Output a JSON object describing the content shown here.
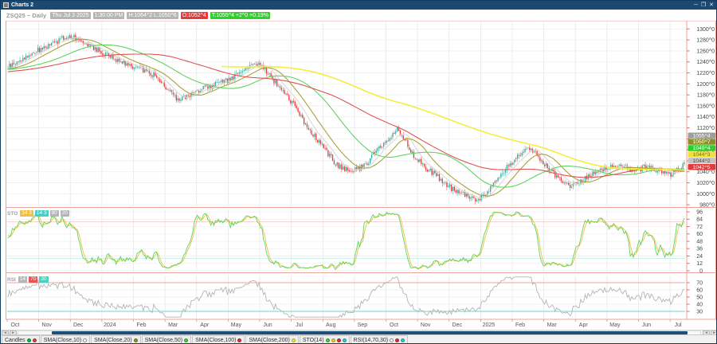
{
  "window": {
    "title": "Charts 2",
    "controls": [
      {
        "name": "minimize",
        "glyph": "─"
      },
      {
        "name": "maximize",
        "glyph": "❐"
      },
      {
        "name": "close",
        "glyph": "✕"
      }
    ]
  },
  "toolbar": {
    "symbol": "ZSQ25 ~ Daily",
    "date_badge": "Thu Jul 3 2025",
    "time_badge": "1:30:00 PM",
    "high_low_badge": "H:1064^2 L:1050^6",
    "open_badge": "O:1052^4",
    "last_badge": "T:1055^4 +2^0 +0.19%"
  },
  "chart_data": {
    "type": "candlestick",
    "symbol": "ZSQ25",
    "timeframe": "Daily",
    "x_axis_labels": [
      "Oct",
      "Nov",
      "Dec",
      "2024",
      "Feb",
      "Mar",
      "Apr",
      "May",
      "Jun",
      "Jul",
      "Aug",
      "Sep",
      "Oct",
      "Nov",
      "Dec",
      "2025",
      "Feb",
      "Mar",
      "Apr",
      "May",
      "Jun",
      "Jul"
    ],
    "days_per_month": 21,
    "price_axis": {
      "tick_min": 980,
      "tick_max": 1300,
      "tick_step": 20,
      "tick_suffix": "^0"
    },
    "last_price": "1055^4",
    "price_anchors_day_price": [
      [
        0,
        1230
      ],
      [
        8,
        1243
      ],
      [
        16,
        1256
      ],
      [
        24,
        1266
      ],
      [
        32,
        1276
      ],
      [
        40,
        1287
      ],
      [
        48,
        1283
      ],
      [
        56,
        1268
      ],
      [
        63,
        1256
      ],
      [
        70,
        1247
      ],
      [
        77,
        1240
      ],
      [
        84,
        1231
      ],
      [
        91,
        1225
      ],
      [
        98,
        1215
      ],
      [
        105,
        1195
      ],
      [
        112,
        1172
      ],
      [
        119,
        1176
      ],
      [
        126,
        1188
      ],
      [
        133,
        1194
      ],
      [
        140,
        1200
      ],
      [
        147,
        1207
      ],
      [
        154,
        1220
      ],
      [
        160,
        1233
      ],
      [
        165,
        1238
      ],
      [
        170,
        1229
      ],
      [
        177,
        1206
      ],
      [
        184,
        1183
      ],
      [
        191,
        1160
      ],
      [
        198,
        1127
      ],
      [
        205,
        1100
      ],
      [
        212,
        1075
      ],
      [
        219,
        1052
      ],
      [
        226,
        1043
      ],
      [
        233,
        1044
      ],
      [
        240,
        1060
      ],
      [
        247,
        1085
      ],
      [
        254,
        1100
      ],
      [
        259,
        1117
      ],
      [
        264,
        1098
      ],
      [
        270,
        1070
      ],
      [
        277,
        1048
      ],
      [
        284,
        1035
      ],
      [
        291,
        1018
      ],
      [
        298,
        1004
      ],
      [
        305,
        996
      ],
      [
        312,
        988
      ],
      [
        319,
        1002
      ],
      [
        326,
        1028
      ],
      [
        333,
        1052
      ],
      [
        340,
        1072
      ],
      [
        346,
        1083
      ],
      [
        352,
        1070
      ],
      [
        358,
        1052
      ],
      [
        365,
        1030
      ],
      [
        372,
        1015
      ],
      [
        379,
        1018
      ],
      [
        386,
        1032
      ],
      [
        393,
        1040
      ],
      [
        400,
        1048
      ],
      [
        407,
        1053
      ],
      [
        414,
        1044
      ],
      [
        421,
        1046
      ],
      [
        428,
        1050
      ],
      [
        435,
        1038
      ],
      [
        441,
        1036
      ],
      [
        446,
        1046
      ],
      [
        450,
        1055.5
      ]
    ],
    "prehistory_anchors": [
      [
        -240,
        1165
      ],
      [
        -180,
        1185
      ],
      [
        -120,
        1205
      ],
      [
        -60,
        1222
      ]
    ],
    "candle_colors": {
      "up": "#2fa89a",
      "down": "#e23b3b"
    },
    "overlays": [
      {
        "name": "SMA(Close,10)",
        "period": 10,
        "color": "#d9d9d9",
        "last_value": "1044^2"
      },
      {
        "name": "SMA(Close,20)",
        "period": 20,
        "color": "#a8a23c",
        "last_value": "1050^7"
      },
      {
        "name": "SMA(Close,50)",
        "period": 50,
        "color": "#5fd45f",
        "last_value": "1049^4"
      },
      {
        "name": "SMA(Close,100)",
        "period": 100,
        "color": "#e05252",
        "last_value": "1042^5"
      },
      {
        "name": "SMA(Close,200)",
        "period": 200,
        "color": "#f7ec3f",
        "last_value": "1044^3",
        "visible_from_day": 142
      }
    ],
    "axis_badges": [
      {
        "label": "1055^4",
        "bg": "#9e9e9e",
        "fg": "#ffffff",
        "name": "last-price-badge"
      },
      {
        "label": "1050^7",
        "bg": "#8f8f2a",
        "fg": "#ffffff",
        "name": "sma20-value-badge"
      },
      {
        "label": "1049^4",
        "bg": "#2fcf2f",
        "fg": "#ffffff",
        "name": "sma50-value-badge"
      },
      {
        "label": "1044^3",
        "bg": "#f0e03c",
        "fg": "#777733",
        "name": "sma200-value-badge"
      },
      {
        "label": "1044^2",
        "bg": "#c4c4c4",
        "fg": "#555555",
        "name": "sma10-value-badge"
      },
      {
        "label": "1042^5",
        "bg": "#e23b3b",
        "fg": "#ffffff",
        "name": "sma100-value-badge"
      }
    ],
    "studies": [
      {
        "name": "STO",
        "params": "14",
        "k_color": "#5fd45f",
        "d_color": "#f0c040",
        "ticks": [
          96,
          84,
          72,
          60,
          48,
          36,
          24,
          12,
          0
        ],
        "overbought": 80,
        "oversold": 20
      },
      {
        "name": "RSI",
        "params": "14,70,30",
        "color": "#b4b4b4",
        "ticks": [
          70,
          60,
          50,
          40,
          30
        ],
        "overbought": 70,
        "oversold": 30
      }
    ]
  },
  "sto_header": {
    "label": "STO",
    "badges": [
      {
        "text": "14 3",
        "bg": "#f0c040",
        "fg": "#ffffff"
      },
      {
        "text": "14 3",
        "bg": "#49cfc4",
        "fg": "#ffffff"
      },
      {
        "text": "80",
        "bg": "#b5b5b5",
        "fg": "#ffffff"
      },
      {
        "text": "20",
        "bg": "#b5b5b5",
        "fg": "#ffffff"
      }
    ]
  },
  "rsi_header": {
    "label": "RSI",
    "badges": [
      {
        "text": "14",
        "bg": "#b5b5b5",
        "fg": "#ffffff"
      },
      {
        "text": "70",
        "bg": "#e85555",
        "fg": "#ffffff"
      },
      {
        "text": "30",
        "bg": "#49cfc4",
        "fg": "#ffffff"
      }
    ]
  },
  "legend": {
    "items": [
      {
        "label": "Candles",
        "dots": [
          "#17a94a",
          "#e23b3b"
        ]
      },
      {
        "label": "SMA(Close,10)",
        "dots": [
          "#ffffff"
        ]
      },
      {
        "label": "SMA(Close,20)",
        "dots": [
          "#8f8f2a"
        ]
      },
      {
        "label": "SMA(Close,50)",
        "dots": [
          "#35d435"
        ]
      },
      {
        "label": "SMA(Close,100)",
        "dots": [
          "#d23333"
        ]
      },
      {
        "label": "SMA(Close,200)",
        "dots": [
          "#f0e03c"
        ]
      },
      {
        "label": "STO(14)",
        "dots": [
          "#35d435",
          "#f0c040",
          "#d23333",
          "#35c8c8"
        ]
      },
      {
        "label": "RSI(14,70,30)",
        "dots": [
          "#ffffff",
          "#d23333",
          "#35c8c8"
        ]
      }
    ]
  },
  "scrollbar": {
    "left_buttons": [
      "◂",
      "▸"
    ],
    "right_buttons": [
      "◂",
      "▸"
    ]
  }
}
